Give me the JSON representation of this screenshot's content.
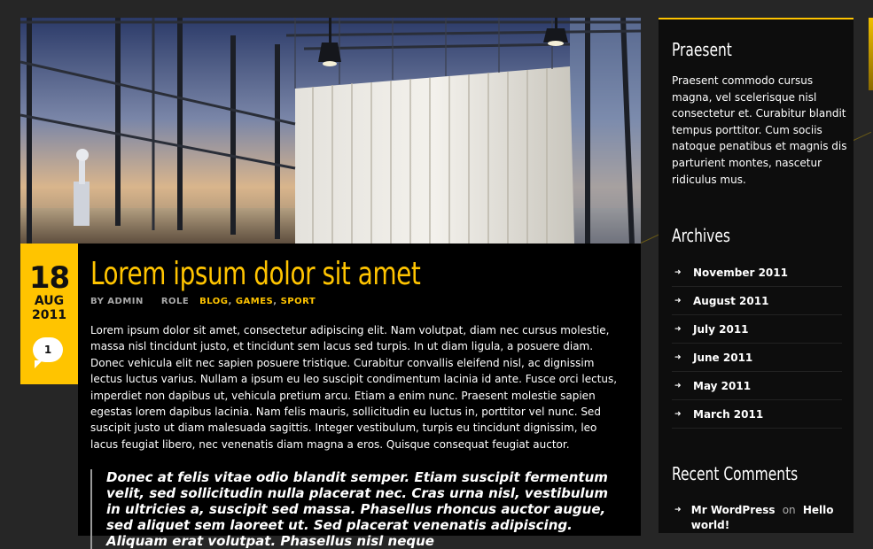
{
  "post": {
    "date": {
      "day": "18",
      "month": "AUG",
      "year": "2011"
    },
    "comment_count": "1",
    "title": "Lorem ipsum dolor sit amet",
    "meta": {
      "author_prefix": "BY ADMIN",
      "role_label": "ROLE",
      "categories": [
        "BLOG",
        "GAMES",
        "SPORT"
      ],
      "separator": ","
    },
    "body": "Lorem ipsum dolor sit amet, consectetur adipiscing elit. Nam volutpat, diam nec cursus molestie, massa nisl tincidunt justo, et tincidunt sem lacus sed turpis. In ut diam ligula, a posuere diam. Donec vehicula elit nec sapien posuere tristique. Curabitur convallis eleifend nisl, ac dignissim lectus luctus varius. Nullam a ipsum eu leo suscipit condimentum lacinia id ante. Fusce orci lectus, imperdiet non dapibus ut, vehicula pretium arcu. Etiam a enim nunc. Praesent molestie sapien egestas lorem dapibus lacinia. Nam felis mauris, sollicitudin eu luctus in, porttitor vel nunc. Sed suscipit justo ut diam malesuada sagittis. Integer vestibulum, turpis eu tincidunt dignissim, leo lacus feugiat libero, nec venenatis diam magna a eros. Quisque consequat feugiat auctor.",
    "quote": "Donec at felis vitae odio blandit semper. Etiam suscipit fermentum velit, sed sollicitudin nulla placerat nec. Cras urna nisl, vestibulum in ultricies a, suscipit sed massa. Phasellus rhoncus auctor augue, sed aliquet sem laoreet ut. Sed placerat venenatis adipiscing. Aliquam erat volutpat. Phasellus nisl neque"
  },
  "sidebar": {
    "text_widget": {
      "title": "Praesent",
      "text": "Praesent commodo cursus magna, vel scelerisque nisl consectetur et. Curabitur blandit tempus porttitor. Cum sociis natoque penatibus et magnis dis parturient montes, nascetur ridiculus mus."
    },
    "archives": {
      "title": "Archives",
      "items": [
        "November 2011",
        "August 2011",
        "July 2011",
        "June 2011",
        "May 2011",
        "March 2011"
      ]
    },
    "recent_comments": {
      "title": "Recent Comments",
      "author": "Mr WordPress",
      "on": "on",
      "post": "Hello world!"
    }
  },
  "colors": {
    "accent": "#ffc400",
    "background": "#262626",
    "panel": "#000000"
  },
  "icons": [
    "arrow-right-icon",
    "comment-bubble-icon"
  ]
}
